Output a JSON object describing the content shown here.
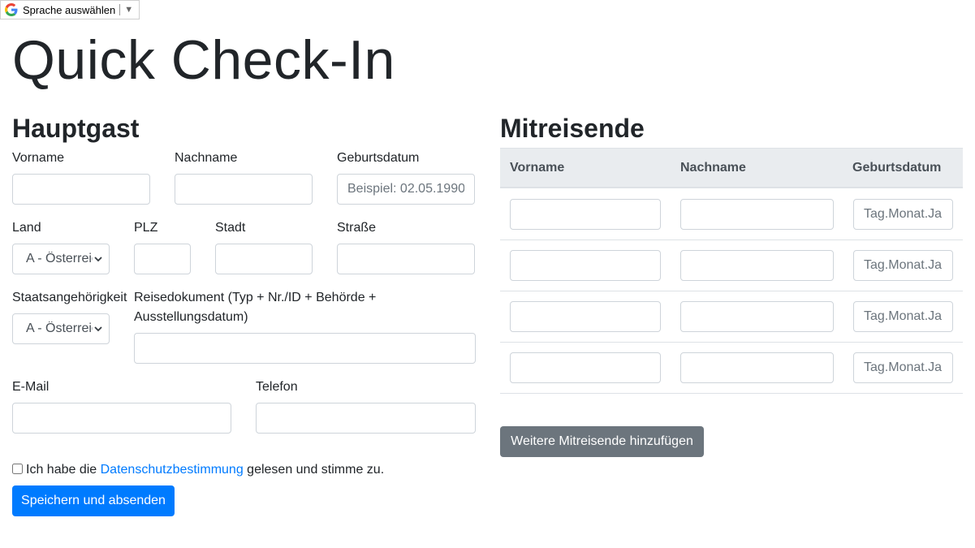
{
  "translate_widget": {
    "label": "Sprache auswählen",
    "arrow": "▼",
    "icon": "google-g-icon"
  },
  "title": "Quick Check-In",
  "main_guest": {
    "heading": "Hauptgast",
    "first_name_label": "Vorname",
    "first_name_value": "",
    "last_name_label": "Nachname",
    "last_name_value": "",
    "birthdate_label": "Geburtsdatum",
    "birthdate_placeholder": "Beispiel: 02.05.1990",
    "country_label": "Land",
    "country_value": "A - Österreich",
    "zip_label": "PLZ",
    "city_label": "Stadt",
    "street_label": "Straße",
    "nationality_label": "Staatsangehörigkeit",
    "nationality_value": "A - Österreich",
    "travel_doc_label_line1": "Reisedokument (Typ + Nr./ID + Behörde +",
    "travel_doc_label_line2": "Ausstellungsdatum)",
    "email_label": "E-Mail",
    "phone_label": "Telefon"
  },
  "companions": {
    "heading": "Mitreisende",
    "columns": [
      "Vorname",
      "Nachname",
      "Geburtsdatum"
    ],
    "birthdate_placeholder": "Tag.Monat.Jahr",
    "row_count": 4,
    "add_button": "Weitere Mitreisende hinzufügen"
  },
  "consent": {
    "checked": false,
    "prefix": "Ich habe die ",
    "link": "Datenschutzbestimmung",
    "suffix": " gelesen und stimme zu."
  },
  "submit_button": "Speichern und absenden",
  "colors": {
    "primary": "#007bff",
    "secondary": "#6c757d",
    "table_header": "#e9ecef"
  }
}
